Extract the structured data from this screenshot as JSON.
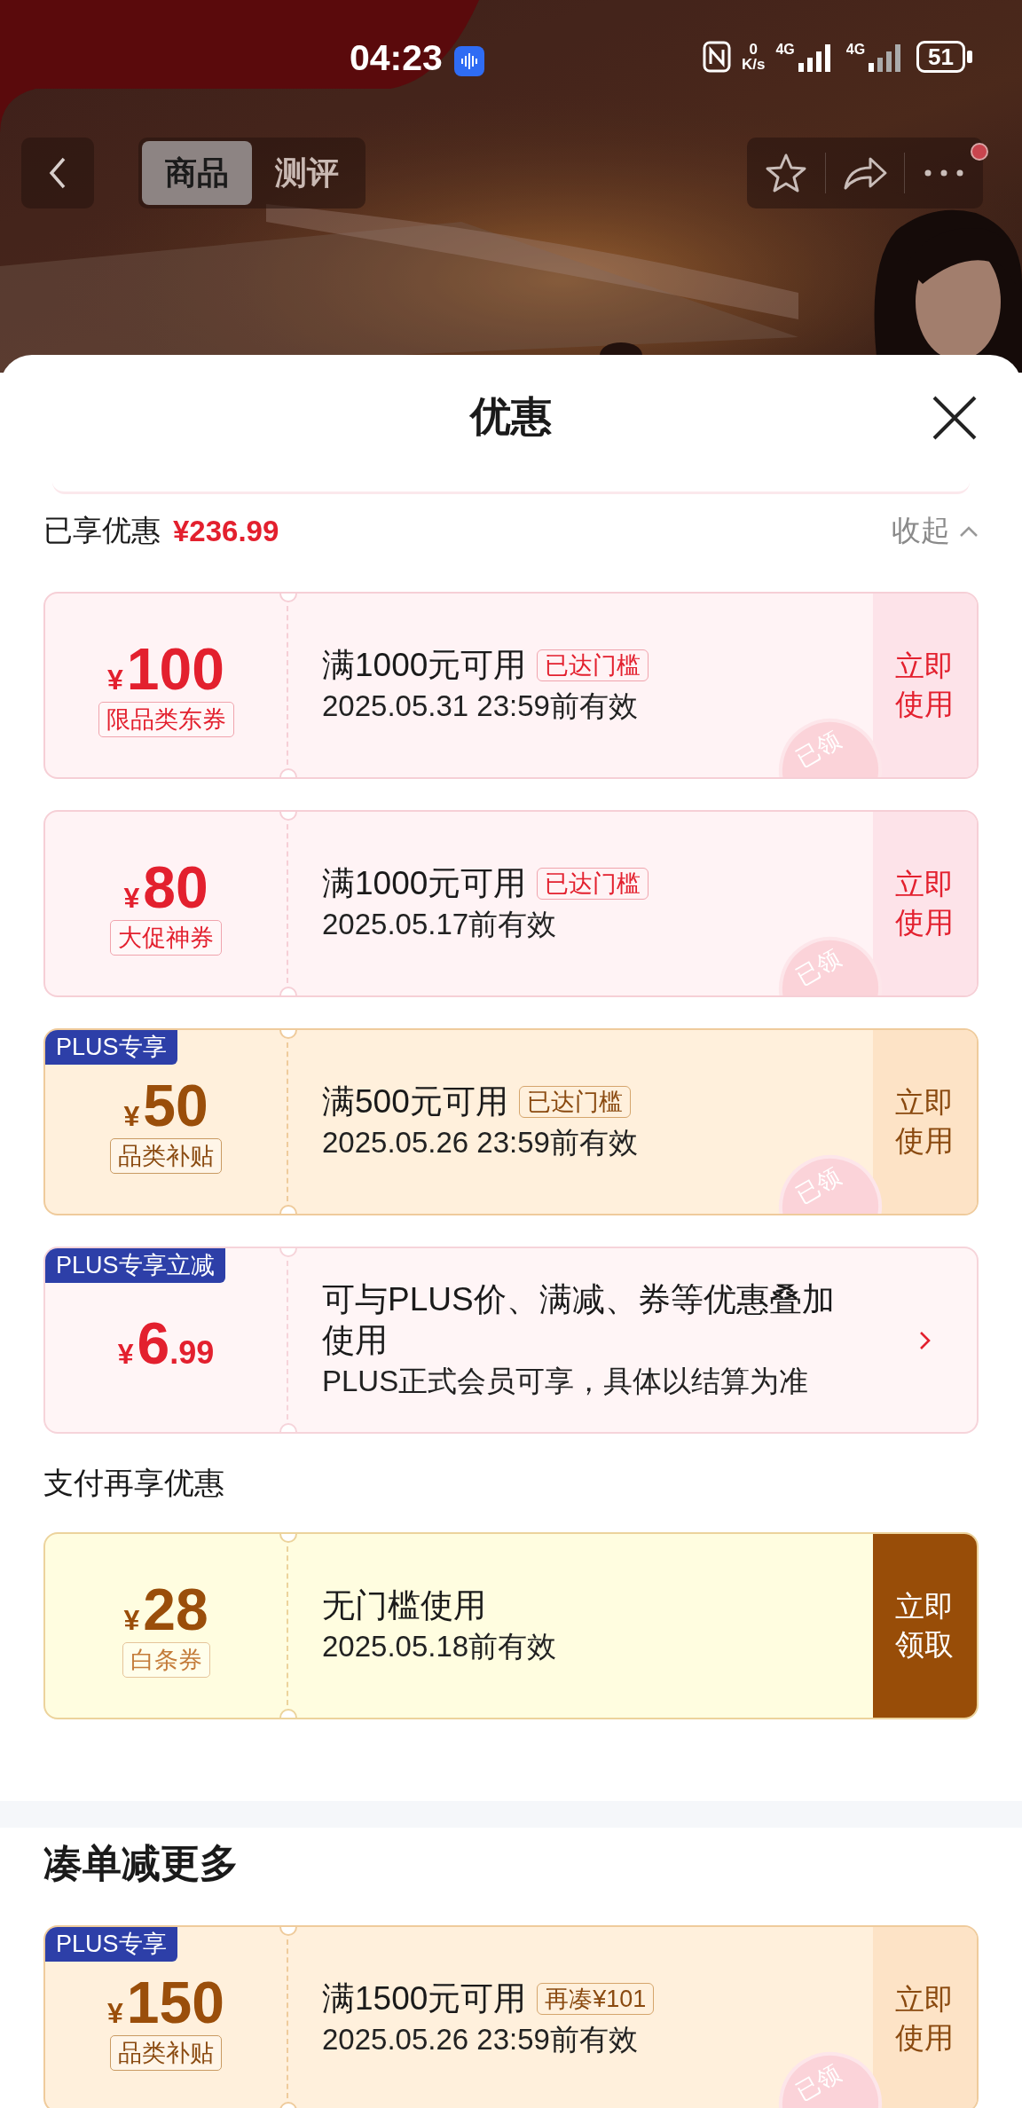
{
  "status_bar": {
    "time": "04:23",
    "speed_value": "0",
    "speed_unit": "K/s",
    "network_1": "4G",
    "network_2": "4G",
    "battery": "51"
  },
  "nav": {
    "tabs": [
      {
        "label": "商品",
        "selected": true
      },
      {
        "label": "测评",
        "selected": false
      }
    ],
    "notification_dot": true
  },
  "sheet": {
    "title": "优惠",
    "saved_label": "已享优惠",
    "saved_amount": "¥236.99",
    "collapse_label": "收起"
  },
  "coupons": [
    {
      "kind": "red",
      "currency": "¥",
      "amount": "100",
      "label": "限品类东券",
      "condition": "满1000元可用",
      "tag": "已达门槛",
      "validity": "2025.05.31 23:59前有效",
      "action": "立即使用",
      "stamp": "已领"
    },
    {
      "kind": "red",
      "currency": "¥",
      "amount": "80",
      "label": "大促神券",
      "condition": "满1000元可用",
      "tag": "已达门槛",
      "validity": "2025.05.17前有效",
      "action": "立即使用",
      "stamp": "已领"
    },
    {
      "kind": "gold",
      "badge": "PLUS专享",
      "currency": "¥",
      "amount": "50",
      "label": "品类补贴",
      "condition": "满500元可用",
      "tag": "已达门槛",
      "validity": "2025.05.26 23:59前有效",
      "action": "立即使用",
      "stamp": "已领"
    },
    {
      "kind": "info",
      "badge": "PLUS专享立减",
      "currency": "¥",
      "amount": "6",
      "decimals": ".99",
      "condition": "可与PLUS价、满减、券等优惠叠加使用",
      "validity": "PLUS正式会员可享，具体以结算为准"
    }
  ],
  "pay_section": {
    "title": "支付再享优惠",
    "coupons": [
      {
        "kind": "pay",
        "currency": "¥",
        "amount": "28",
        "label": "白条券",
        "condition": "无门槛使用",
        "validity": "2025.05.18前有效",
        "action": "立即领取"
      }
    ]
  },
  "more_section": {
    "title": "凑单减更多",
    "coupons": [
      {
        "kind": "gold",
        "badge": "PLUS专享",
        "currency": "¥",
        "amount": "150",
        "label": "品类补贴",
        "condition": "满1500元可用",
        "tag": "再凑¥101",
        "validity": "2025.05.26 23:59前有效",
        "action": "立即使用",
        "stamp": "已领"
      }
    ]
  }
}
